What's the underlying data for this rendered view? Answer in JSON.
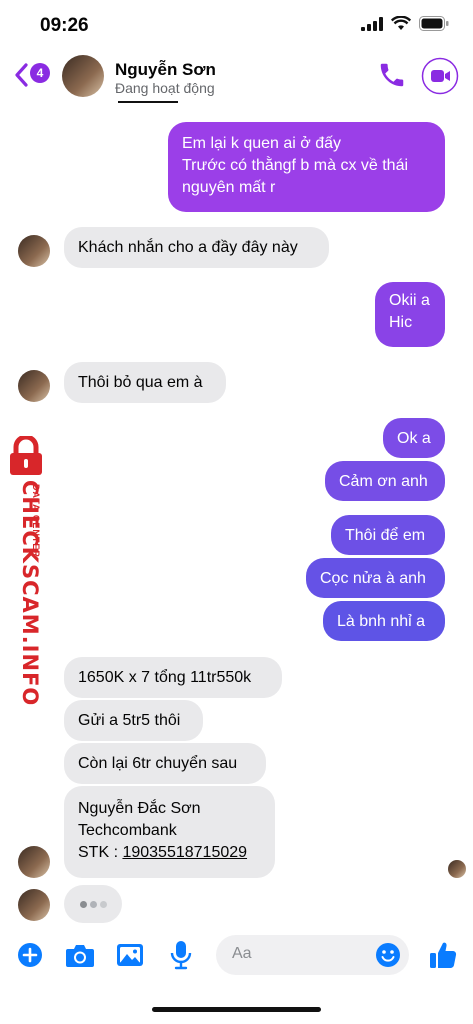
{
  "status_bar": {
    "time": "09:26"
  },
  "header": {
    "back_badge": "4",
    "contact_name": "Nguyễn Sơn",
    "contact_status": "Đang hoạt động"
  },
  "messages": {
    "m1": [
      "Em lại k quen ai ở đấy",
      "Trước có thằngf b mà cx về thái",
      "nguyên mất r"
    ],
    "m2": "Khách nhắn cho a đầy đây này",
    "m3": [
      "Okii a",
      "Hic"
    ],
    "m4": "Thôi bỏ qua em à",
    "m5": "Ok a",
    "m6": "Cảm ơn anh",
    "m7": "Thôi để em",
    "m8": "Cọc nửa à anh",
    "m9": "Là bnh nhỉ a",
    "m10": "1650K x 7 tổng 11tr550k",
    "m11": "Gửi a 5tr5 thôi",
    "m12": "Còn lại 6tr chuyển sau",
    "m13": {
      "line1": "Nguyễn Đắc Sơn",
      "line2": "Techcombank",
      "stk_label": "STK : ",
      "stk_number": "19035518715029"
    }
  },
  "watermark": {
    "brand": "CHECKSCAM.INFO",
    "tagline": "DATA CENTER"
  },
  "composer": {
    "placeholder": "Aa"
  },
  "colors": {
    "accent": "#8a2be2",
    "bubble_out_top": "#9b3fe8",
    "bubble_out_bottom": "#5b53e6",
    "bubble_in": "#e9e9eb",
    "watermark": "#d8262a"
  },
  "icons": [
    "back-chevron-icon",
    "phone-icon",
    "video-camera-icon",
    "plus-icon",
    "camera-icon",
    "image-icon",
    "microphone-icon",
    "emoji-icon",
    "thumbs-up-icon"
  ]
}
